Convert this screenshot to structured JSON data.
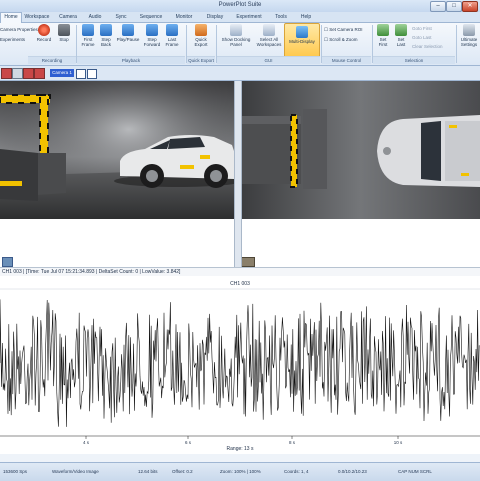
{
  "app": {
    "title": "PowerPlot Suite"
  },
  "window_buttons": [
    "–",
    "□",
    "✕"
  ],
  "tabs": [
    {
      "label": "Home",
      "active": true
    },
    {
      "label": "Workspace"
    },
    {
      "label": "Camera"
    },
    {
      "label": "Audio"
    },
    {
      "label": "Sync"
    },
    {
      "label": "Sequence"
    },
    {
      "label": "Monitor"
    },
    {
      "label": "Display"
    },
    {
      "label": "Experiment"
    },
    {
      "label": "Tools"
    },
    {
      "label": "Help"
    }
  ],
  "ribbon": {
    "camera_properties": "Camera Properties",
    "experiments": "Experiments",
    "record": "Record",
    "stop": "Stop",
    "first_frame": "First Frame",
    "step_back": "Step Back",
    "play_pause": "Play/Pause",
    "step_forward": "Step Forward",
    "last_frame": "Last Frame",
    "quick_export": "Quick Export",
    "show_docking_panel": "Show Docking Panel",
    "select_all_workspaces": "Select All Workspaces",
    "multi_display": "Multi-Display",
    "set_camera_roi": "Set Camera ROI",
    "scroll_zoom": "Scroll & Zoom",
    "set_first": "Set First",
    "set_last": "Set Last",
    "goto_first": "Goto First",
    "goto_last": "Goto Last",
    "clear_selection": "Clear Selection",
    "ultimate_settings": "Ultimate Settings",
    "groups": {
      "recording": "Recording",
      "playback": "Playback",
      "quick_export": "Quick Export",
      "gui": "GUI",
      "mouse_control": "Mouse Control",
      "selection": "Selection"
    }
  },
  "camera_toolbar": {
    "active_camera": "Camera 1"
  },
  "channel_info": {
    "text": "CH1 003 | [Time: Tue Jul 07 15:21:34.893 | DeltaSet Count: 0 | LowValue: 3.842]"
  },
  "waveform": {
    "channel_title": "CH1 003",
    "tick_labels": [
      "4 s",
      "6 s",
      "8 s",
      "10 s"
    ],
    "range_label": "Range: 13 s"
  },
  "status": {
    "sample_rate": "153600 Sps",
    "source": "Waveform/Video Image",
    "bits": "12.64 bits",
    "offset": "Offset: 0.2",
    "zoom": "Zoom: 100% | 100%",
    "coords": "Coords: 1, 4",
    "range": "0.0/10.2/10.23",
    "mode": "CAP NUM SCRL"
  },
  "colors": {
    "accent": "#2f5fd1",
    "record": "#e0402a",
    "ribbon_bg": "#dde8f5"
  }
}
